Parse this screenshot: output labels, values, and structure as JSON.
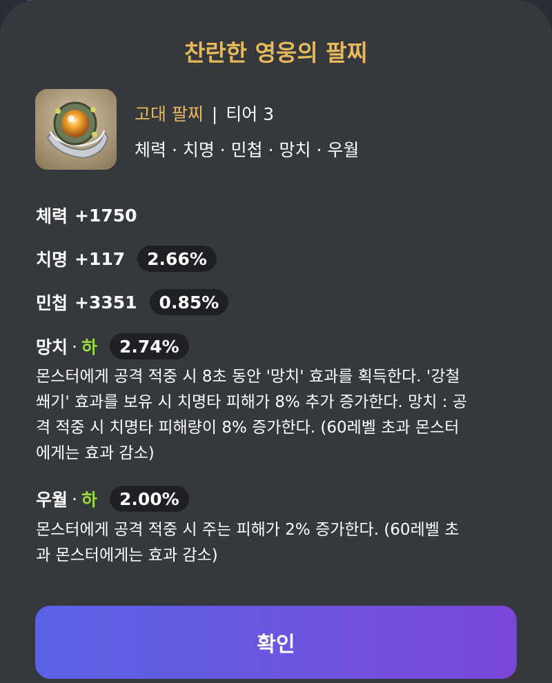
{
  "modal": {
    "title": "찬란한 영웅의 팔찌",
    "item": {
      "grade": "고대 팔찌",
      "separator": "|",
      "tier": "티어 3",
      "effects_line": "체력 · 치명 · 민첩 · 망치 · 우월"
    },
    "stats": [
      {
        "label": "체력",
        "value": "+1750"
      },
      {
        "label": "치명",
        "value": "+117",
        "percent": "2.66%"
      },
      {
        "label": "민첩",
        "value": "+3351",
        "percent": "0.85%"
      }
    ],
    "special_effects": [
      {
        "name": "망치",
        "dot": "·",
        "grade": "하",
        "percent": "2.74%",
        "lines": [
          "몬스터에게 공격 적중 시 8초 동안 '망치' 효과를 획득한다. '강철",
          "쐐기' 효과를 보유 시 치명타 피해가 8% 추가 증가한다. 망치 : 공",
          "격 적중 시 치명타 피해량이 8% 증가한다. (60레벨 초과 몬스터",
          "에게는 효과 감소)"
        ]
      },
      {
        "name": "우월",
        "dot": "·",
        "grade": "하",
        "percent": "2.00%",
        "lines": [
          "몬스터에게 공격 적중 시 주는 피해가 2% 증가한다. (60레벨 초",
          "과 몬스터에게는 효과 감소)"
        ]
      }
    ],
    "confirm_label": "확인"
  },
  "colors": {
    "title_gold": "#e8b95a",
    "grade_green": "#9bdc3c",
    "panel_bg": "#35383d",
    "pill_bg": "#1e2024",
    "button_gradient_start": "#5a63e6",
    "button_gradient_end": "#7a46d8"
  },
  "icons": {
    "item_icon": "bracelet-item-icon"
  }
}
